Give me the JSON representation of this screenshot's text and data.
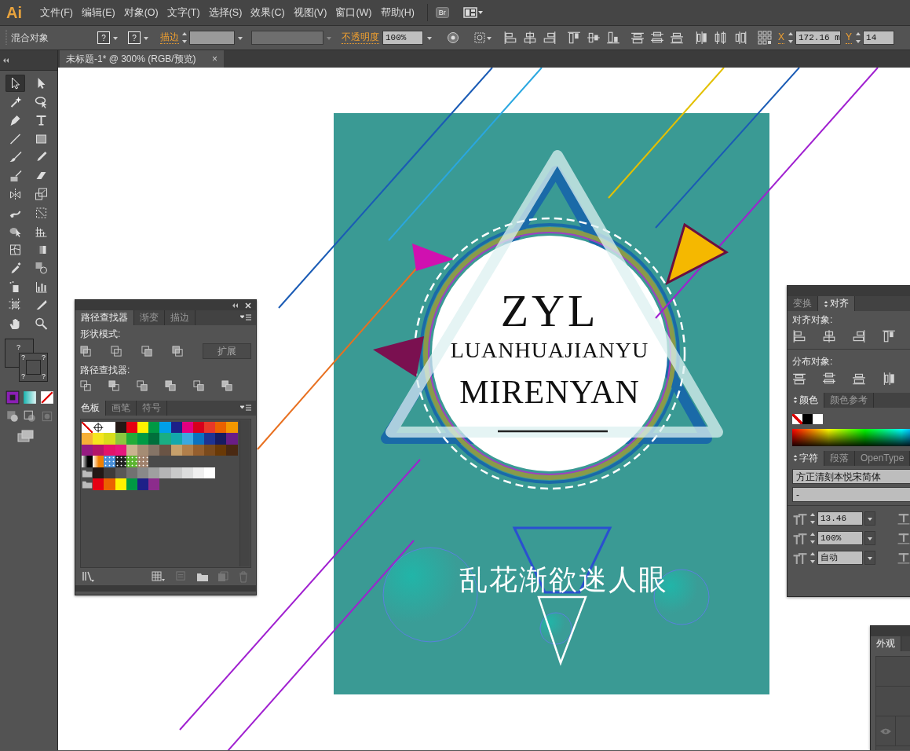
{
  "menubar": {
    "logo": "Ai",
    "items": [
      "文件(F)",
      "编辑(E)",
      "对象(O)",
      "文字(T)",
      "选择(S)",
      "效果(C)",
      "视图(V)",
      "窗口(W)",
      "帮助(H)"
    ],
    "bridge_button": "Br"
  },
  "control_bar": {
    "object_type": "混合对象",
    "fill_value": "?",
    "stroke_value": "?",
    "stroke_label": "描边",
    "opacity_label": "不透明度",
    "opacity_value": "100%",
    "x_label": "X",
    "x_value": "172.16 m",
    "y_label": "Y",
    "y_value": "14"
  },
  "toolbar": {
    "tools": [
      {
        "selected": true
      },
      {
        "selected": false
      },
      {
        "selected": false
      },
      {
        "selected": false
      },
      {
        "selected": false
      },
      {
        "selected": false
      },
      {
        "selected": false
      },
      {
        "selected": false
      },
      {
        "selected": false
      },
      {
        "selected": false
      },
      {
        "selected": false
      },
      {
        "selected": false
      },
      {
        "selected": false
      },
      {
        "selected": false
      },
      {
        "selected": false
      },
      {
        "selected": false
      },
      {
        "selected": false
      },
      {
        "selected": false
      },
      {
        "selected": false
      },
      {
        "selected": false
      },
      {
        "selected": false
      },
      {
        "selected": false
      },
      {
        "selected": false
      },
      {
        "selected": false
      },
      {
        "selected": false
      },
      {
        "selected": false
      },
      {
        "selected": false
      },
      {
        "selected": false
      }
    ],
    "fill": "?",
    "stroke_marks": [
      "?",
      "?",
      "?",
      "?"
    ]
  },
  "document_tab": {
    "title": "未标题-1* @ 300% (RGB/预览)",
    "close": "×"
  },
  "artwork": {
    "title": "ZYL",
    "subtitle": "LUANHUAJIANYU",
    "name": "MIRENYAN",
    "slogan": "乱花渐欲迷人眼"
  },
  "pathfinder_panel": {
    "tabs": [
      {
        "label": "路径查找器",
        "selected": true,
        "options_icon": false
      },
      {
        "label": "渐变",
        "selected": false,
        "options_icon": false
      },
      {
        "label": "描边",
        "selected": false,
        "options_icon": false
      }
    ],
    "shape_modes_label": "形状模式:",
    "expand_button": "扩展",
    "pathfinders_label": "路径查找器:"
  },
  "swatches_panel": {
    "tabs": [
      {
        "label": "色板",
        "selected": true,
        "options_icon": false
      },
      {
        "label": "画笔",
        "selected": false,
        "options_icon": false
      },
      {
        "label": "符号",
        "selected": false,
        "options_icon": false
      }
    ],
    "rows": [
      [
        {
          "kind": "none"
        },
        {
          "kind": "registration"
        },
        {
          "kind": "color",
          "color": "#ffffff"
        },
        {
          "kind": "color",
          "color": "#231815"
        },
        {
          "kind": "color",
          "color": "#e60012"
        },
        {
          "kind": "color",
          "color": "#fff100"
        },
        {
          "kind": "color",
          "color": "#009944"
        },
        {
          "kind": "color",
          "color": "#00a0e9"
        },
        {
          "kind": "color",
          "color": "#1d2088"
        },
        {
          "kind": "color",
          "color": "#e4007f"
        },
        {
          "kind": "color",
          "color": "#d7001c"
        },
        {
          "kind": "color",
          "color": "#e83828"
        },
        {
          "kind": "color",
          "color": "#eb6100"
        },
        {
          "kind": "color",
          "color": "#f39800"
        }
      ],
      [
        {
          "kind": "color",
          "color": "#f6b037"
        },
        {
          "kind": "color",
          "color": "#f5e51e"
        },
        {
          "kind": "color",
          "color": "#d9dd1b"
        },
        {
          "kind": "color",
          "color": "#8cc63e"
        },
        {
          "kind": "color",
          "color": "#22ac38"
        },
        {
          "kind": "color",
          "color": "#009a44"
        },
        {
          "kind": "color",
          "color": "#006f3b"
        },
        {
          "kind": "color",
          "color": "#1aae83"
        },
        {
          "kind": "color",
          "color": "#13a8ac"
        },
        {
          "kind": "color",
          "color": "#3ca9e0"
        },
        {
          "kind": "color",
          "color": "#0b72c0"
        },
        {
          "kind": "color",
          "color": "#1e3392"
        },
        {
          "kind": "color",
          "color": "#171c61"
        },
        {
          "kind": "color",
          "color": "#6a1d87"
        }
      ],
      [
        {
          "kind": "color",
          "color": "#951b81"
        },
        {
          "kind": "color",
          "color": "#b3166a"
        },
        {
          "kind": "color",
          "color": "#e3136a"
        },
        {
          "kind": "color",
          "color": "#e5177d"
        },
        {
          "kind": "color",
          "color": "#c9b38f"
        },
        {
          "kind": "color",
          "color": "#a58c74"
        },
        {
          "kind": "color",
          "color": "#857466"
        },
        {
          "kind": "color",
          "color": "#6a5445"
        },
        {
          "kind": "color",
          "color": "#c7a06b"
        },
        {
          "kind": "color",
          "color": "#b17f4a"
        },
        {
          "kind": "color",
          "color": "#955f2e"
        },
        {
          "kind": "color",
          "color": "#7b4a1c"
        },
        {
          "kind": "color",
          "color": "#6a3906"
        },
        {
          "kind": "color",
          "color": "#4a2912"
        }
      ],
      [
        {
          "kind": "gradient",
          "color": "#000000"
        },
        {
          "kind": "gradient",
          "color": "#f08000"
        },
        {
          "kind": "pattern",
          "color": "#4a90d9"
        },
        {
          "kind": "pattern",
          "color": "#222222"
        },
        {
          "kind": "pattern",
          "color": "#5cb531"
        },
        {
          "kind": "pattern",
          "color": "#a0826d"
        }
      ],
      [
        {
          "kind": "folder"
        },
        {
          "kind": "color",
          "color": "#231815"
        },
        {
          "kind": "color",
          "color": "#3e3a39"
        },
        {
          "kind": "color",
          "color": "#595757"
        },
        {
          "kind": "color",
          "color": "#727171"
        },
        {
          "kind": "color",
          "color": "#898989"
        },
        {
          "kind": "color",
          "color": "#9fa0a0"
        },
        {
          "kind": "color",
          "color": "#b5b5b6"
        },
        {
          "kind": "color",
          "color": "#c9caca"
        },
        {
          "kind": "color",
          "color": "#dcdddd"
        },
        {
          "kind": "color",
          "color": "#efefef"
        },
        {
          "kind": "color",
          "color": "#ffffff"
        }
      ],
      [
        {
          "kind": "folder"
        },
        {
          "kind": "color",
          "color": "#e60012"
        },
        {
          "kind": "color",
          "color": "#eb6100"
        },
        {
          "kind": "color",
          "color": "#fff100"
        },
        {
          "kind": "color",
          "color": "#009944"
        },
        {
          "kind": "color",
          "color": "#1d2088"
        },
        {
          "kind": "color",
          "color": "#8c2c8c"
        }
      ]
    ]
  },
  "align_panel": {
    "tabs": [
      {
        "label": "变换",
        "selected": false,
        "options_icon": false
      },
      {
        "label": "对齐",
        "selected": true,
        "options_icon": true
      }
    ],
    "align_label": "对齐对象:",
    "distribute_label": "分布对象:"
  },
  "color_panel": {
    "tabs": [
      {
        "label": "颜色",
        "selected": true,
        "options_icon": true
      },
      {
        "label": "颜色参考",
        "selected": false,
        "options_icon": false
      }
    ]
  },
  "character_panel": {
    "tabs": [
      {
        "label": "字符",
        "selected": true,
        "options_icon": true
      },
      {
        "label": "段落",
        "selected": false,
        "options_icon": false
      },
      {
        "label": "OpenType",
        "selected": false,
        "options_icon": false
      }
    ],
    "font_family": "方正清刻本悦宋简体",
    "font_style": "-",
    "font_size": "13.46",
    "vertical_scale": "100%",
    "tracking": "自动"
  },
  "appearance_panel": {
    "tabs": [
      {
        "label": "外观",
        "selected": true,
        "options_icon": false
      }
    ]
  }
}
